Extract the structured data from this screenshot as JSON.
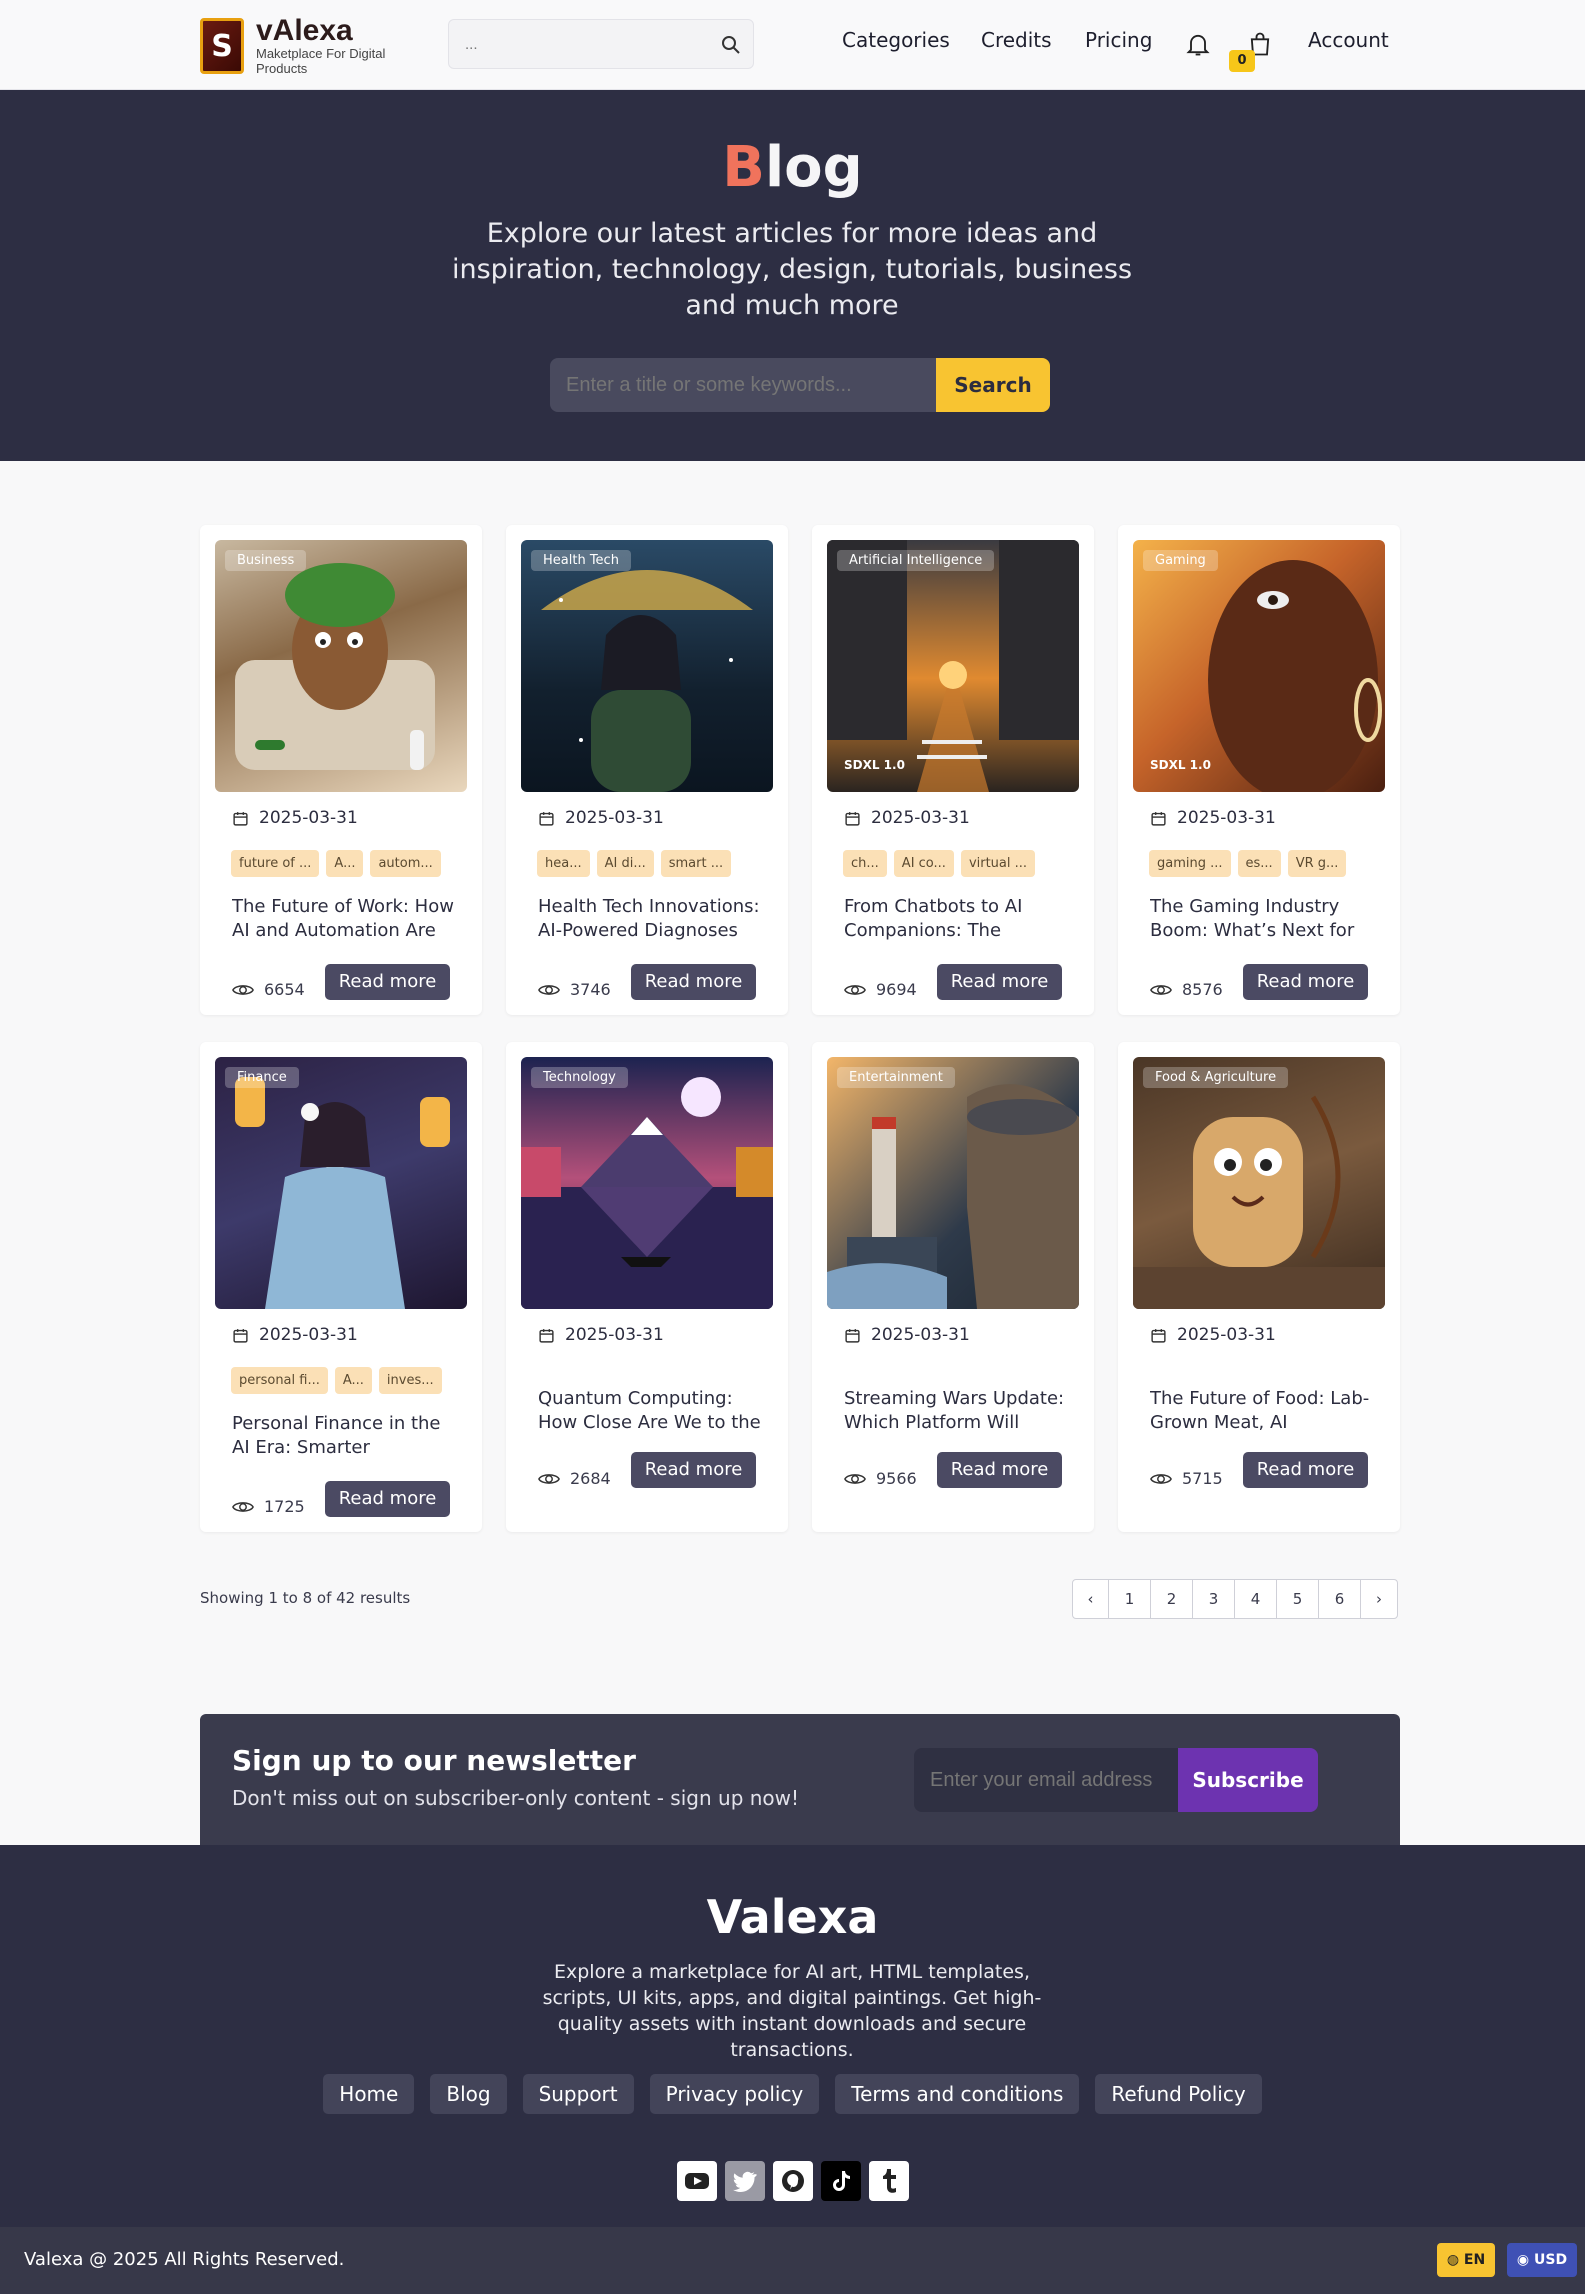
{
  "header": {
    "logo_letter": "S",
    "logo_name": "vAlexa",
    "logo_tagline": "Maketplace For Digital Products",
    "search_placeholder": "...",
    "nav": [
      "Categories",
      "Credits",
      "Pricing"
    ],
    "cart_count": "0",
    "account": "Account"
  },
  "hero": {
    "title_first": "B",
    "title_rest": "log",
    "subtitle": "Explore our latest articles for more ideas and inspiration, technology, design, tutorials, business and much more",
    "search_placeholder": "Enter a title or some keywords...",
    "search_button": "Search"
  },
  "cards": [
    {
      "category": "Business",
      "sdxl": "",
      "date": "2025-03-31",
      "tags": [
        "future of ...",
        "A...",
        "autom..."
      ],
      "title": "The Future of Work: How AI and Automation Are",
      "views": "6654",
      "read": "Read more"
    },
    {
      "category": "Health Tech",
      "sdxl": "",
      "date": "2025-03-31",
      "tags": [
        "hea...",
        "AI di...",
        "smart ..."
      ],
      "title": "Health Tech Innovations: AI-Powered Diagnoses",
      "views": "3746",
      "read": "Read more"
    },
    {
      "category": "Artificial Intelligence",
      "sdxl": "SDXL 1.0",
      "date": "2025-03-31",
      "tags": [
        "ch...",
        "AI co...",
        "virtual ..."
      ],
      "title": "From Chatbots to AI Companions: The",
      "views": "9694",
      "read": "Read more"
    },
    {
      "category": "Gaming",
      "sdxl": "SDXL 1.0",
      "date": "2025-03-31",
      "tags": [
        "gaming ...",
        "es...",
        "VR g..."
      ],
      "title": "The Gaming Industry Boom: What’s Next for",
      "views": "8576",
      "read": "Read more"
    },
    {
      "category": "Finance",
      "sdxl": "",
      "date": "2025-03-31",
      "tags": [
        "personal fi...",
        "A...",
        "inves..."
      ],
      "title": "Personal Finance in the AI Era: Smarter Investing",
      "views": "1725",
      "read": "Read more"
    },
    {
      "category": "Technology",
      "sdxl": "",
      "date": "2025-03-31",
      "tags": [],
      "title": "Quantum Computing: How Close Are We to the",
      "views": "2684",
      "read": "Read more"
    },
    {
      "category": "Entertainment",
      "sdxl": "",
      "date": "2025-03-31",
      "tags": [],
      "title": "Streaming Wars Update: Which Platform Will",
      "views": "9566",
      "read": "Read more"
    },
    {
      "category": "Food & Agriculture",
      "sdxl": "",
      "date": "2025-03-31",
      "tags": [],
      "title": "The Future of Food: Lab-Grown Meat, AI",
      "views": "5715",
      "read": "Read more"
    }
  ],
  "pagination": {
    "showing": "Showing 1 to 8 of 42 results",
    "prev": "‹",
    "pages": [
      "1",
      "2",
      "3",
      "4",
      "5",
      "6"
    ],
    "next": "›"
  },
  "newsletter": {
    "title": "Sign up to our newsletter",
    "subtitle": "Don't miss out on subscriber-only content - sign up now!",
    "placeholder": "Enter your email address",
    "button": "Subscribe"
  },
  "footer": {
    "brand": "Valexa",
    "description": "Explore a marketplace for AI art, HTML templates, scripts, UI kits, apps, and digital paintings. Get high-quality assets with instant downloads and secure transactions.",
    "links": [
      "Home",
      "Blog",
      "Support",
      "Privacy policy",
      "Terms and conditions",
      "Refund Policy"
    ],
    "socials": [
      "youtube-icon",
      "twitter-icon",
      "pinterest-icon",
      "tiktok-icon",
      "tumblr-icon"
    ],
    "copyright": "Valexa @ 2025 All Rights Reserved.",
    "language": "EN",
    "currency": "USD"
  },
  "colors": {
    "hero_bg": "#2d2e43",
    "accent_yellow": "#f8c431",
    "accent_coral": "#f0735c",
    "button_dark": "#4b4a63",
    "subscribe_purple": "#6d33b0"
  }
}
